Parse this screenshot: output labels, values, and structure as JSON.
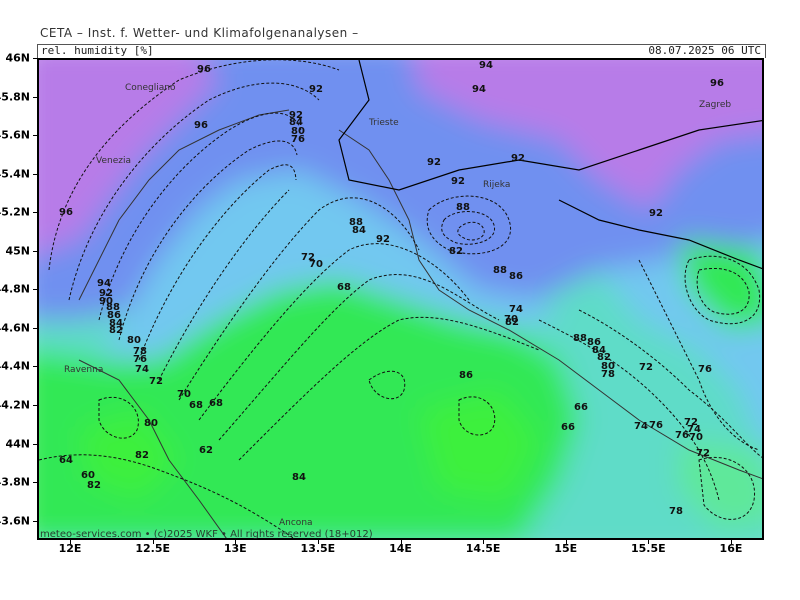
{
  "header": {
    "title": "CETA – Inst. f. Wetter- und Klimafolgenanalysen –",
    "parameter": "rel. humidity [%]",
    "valid_time": "08.07.2025 06 UTC"
  },
  "map": {
    "lat_range": [
      43.5,
      46.0
    ],
    "lon_range": [
      11.8,
      16.2
    ],
    "lat_labels": [
      "46N",
      "45.8N",
      "45.6N",
      "45.4N",
      "45.2N",
      "45N",
      "44.8N",
      "44.6N",
      "44.4N",
      "44.2N",
      "44N",
      "43.8N",
      "43.6N"
    ],
    "lon_labels": [
      "12E",
      "12.5E",
      "13E",
      "13.5E",
      "14E",
      "14.5E",
      "15E",
      "15.5E",
      "16E"
    ],
    "colors": {
      "violet": "#b77be8",
      "blue": "#6f90f0",
      "light_blue": "#72c8f0",
      "cyan": "#5fdcc8",
      "green": "#33e855",
      "bright_green": "#3cf03c"
    },
    "cities": [
      "Conegliano",
      "Venezia",
      "Trieste",
      "Rijeka",
      "Zagreb",
      "Ravenna",
      "Ancona"
    ],
    "contour_labels": [
      "96",
      "92",
      "94",
      "96",
      "94",
      "96",
      "92",
      "84",
      "80",
      "76",
      "92",
      "92",
      "92",
      "88",
      "84",
      "92",
      "92",
      "88",
      "88",
      "86",
      "82",
      "96",
      "82",
      "72",
      "70",
      "68",
      "94",
      "92",
      "90",
      "88",
      "86",
      "84",
      "82",
      "80",
      "78",
      "76",
      "74",
      "72",
      "70",
      "68",
      "74",
      "72",
      "70",
      "88",
      "86",
      "84",
      "82",
      "80",
      "78",
      "76",
      "74",
      "72",
      "78",
      "80",
      "82",
      "62",
      "64",
      "60",
      "82",
      "84",
      "86",
      "66",
      "66",
      "76",
      "76",
      "74",
      "72",
      "70",
      "68"
    ],
    "credit": "meteo-services.com • (c)2025 WKF • All rights reserved (18+012)"
  }
}
